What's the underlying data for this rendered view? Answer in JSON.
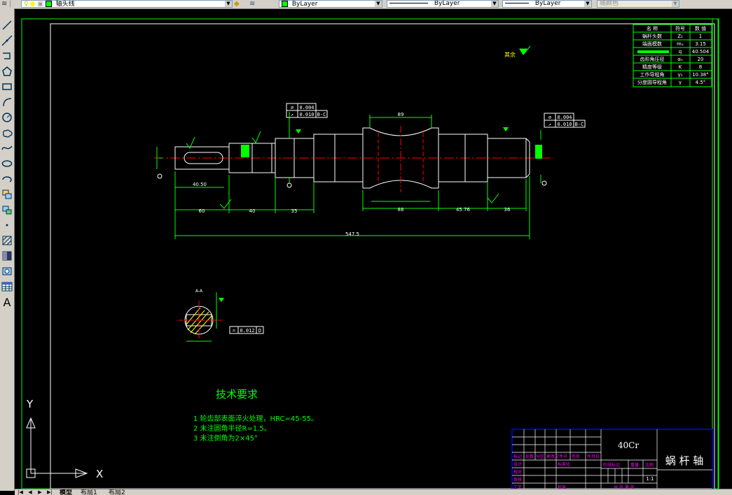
{
  "toolbar": {
    "layer_name": "轴头线",
    "color": "ByLayer",
    "linetype": "ByLayer",
    "lineweight": "ByLayer",
    "plotstyle": "随颜色",
    "layer_swatch": "#00ff00",
    "color_swatch": "#00ff00"
  },
  "draw_tools": [
    "line-icon",
    "construction-line-icon",
    "polyline-icon",
    "polygon-icon",
    "rectangle-icon",
    "arc-icon",
    "circle-icon",
    "revision-cloud-icon",
    "spline-icon",
    "ellipse-icon",
    "ellipse-arc-icon",
    "insert-block-icon",
    "make-block-icon",
    "point-icon",
    "hatch-icon",
    "gradient-icon",
    "region-icon",
    "table-icon",
    "multiline-text-icon"
  ],
  "drawing": {
    "tech_title": "技术要求",
    "tech_notes": [
      "1 轮齿部表面淬火处理，HRC=45-55。",
      "2 未注圆角半径R=1.5。",
      "3 未注倒角为2×45°"
    ],
    "roughness_other": "其余",
    "param_table": {
      "header": [
        "名 称",
        "符号",
        "数 值"
      ],
      "rows": [
        [
          "蜗杆头数",
          "Z₁",
          "1"
        ],
        [
          "端面模数",
          "mₓ",
          "3.15"
        ],
        [
          "",
          "q",
          "40.504"
        ],
        [
          "齿形角压径",
          "αₙ",
          "20"
        ],
        [
          "精度等级",
          "K",
          "8"
        ],
        [
          "工作导程角",
          "γ₁",
          "10.38°"
        ],
        [
          "分度圆导程角",
          "γ",
          "4.5°"
        ]
      ]
    },
    "tolerance_boxes": [
      {
        "sym": "⌀",
        "val": "0.004"
      },
      {
        "sym": "↗",
        "val": "0.010",
        "ref": "B-C"
      },
      {
        "sym": "⌀",
        "val": "0.004"
      },
      {
        "sym": "↗",
        "val": "0.010",
        "ref": "B-C"
      },
      {
        "sym": "=",
        "val": "0.012",
        "ref": "D"
      }
    ],
    "dimensions": {
      "d1": "40.50",
      "d2": "60",
      "d3": "40",
      "d4": "35",
      "d5": "89",
      "d6": "88",
      "d7": "45.76",
      "d8": "36",
      "total": "547.5",
      "section_label": "A-A"
    },
    "title_block": {
      "material": "40Cr",
      "part_name": "蜗 杆 轴",
      "scale": "1:1",
      "labels": [
        "标记",
        "处数",
        "分区",
        "更改文件号",
        "签名",
        "年月日",
        "设计",
        "标准化",
        "阶段标记",
        "重量",
        "比例",
        "校对",
        "审核",
        "工艺",
        "批准",
        "共 张 第 张"
      ]
    },
    "ucs": {
      "x": "X",
      "y": "Y"
    }
  },
  "layout_tabs": [
    "模型",
    "布局1",
    "布局2"
  ]
}
